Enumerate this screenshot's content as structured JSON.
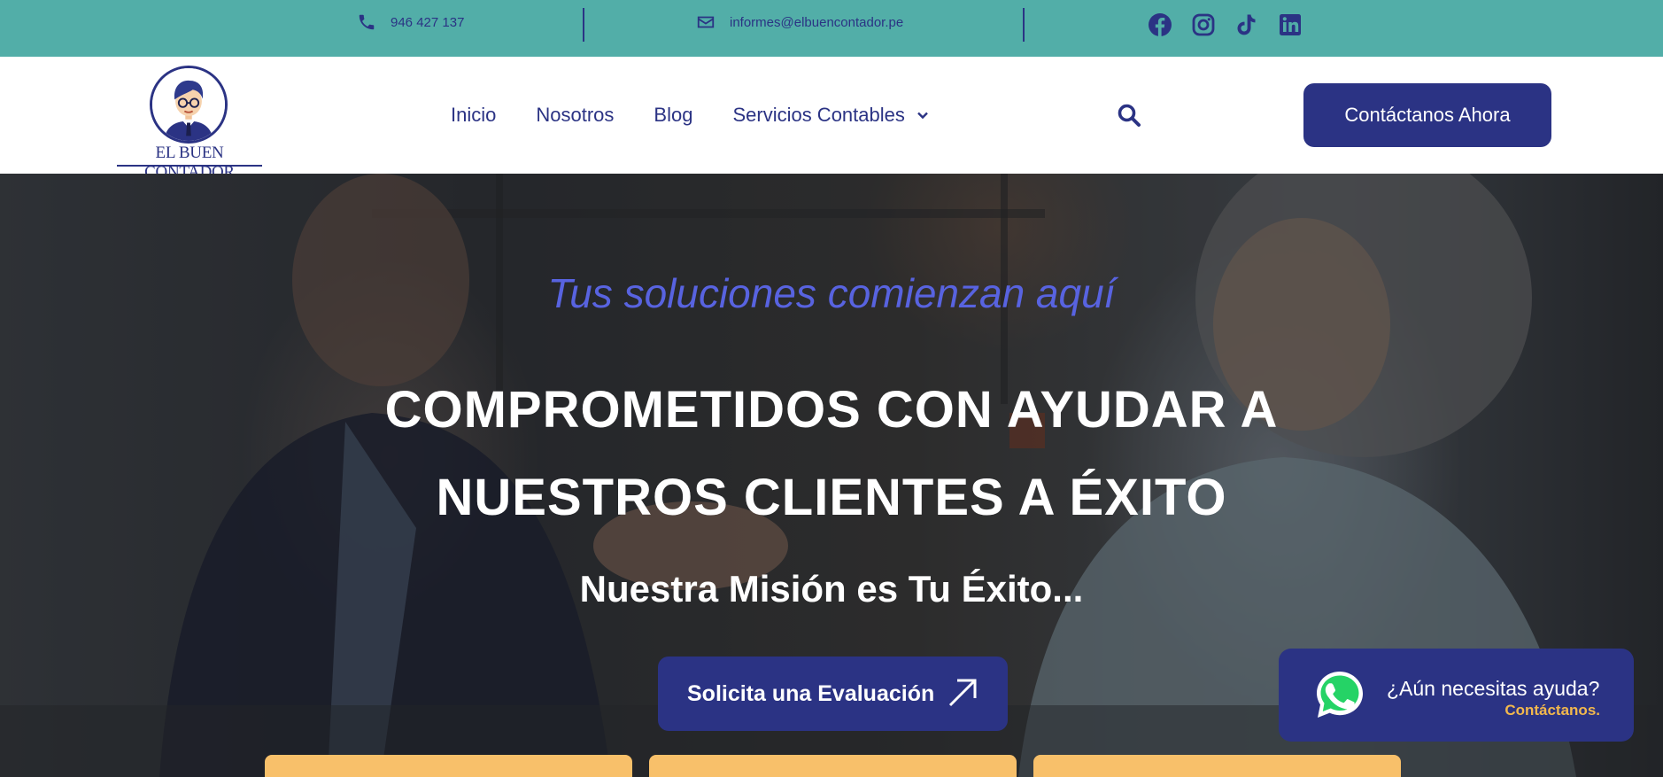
{
  "topbar": {
    "phone": "946 427 137",
    "email": "informes@elbuencontador.pe",
    "socials": [
      "facebook-icon",
      "instagram-icon",
      "tiktok-icon",
      "linkedin-icon"
    ]
  },
  "header": {
    "logo_text": "EL BUEN CONTADOR",
    "nav": [
      "Inicio",
      "Nosotros",
      "Blog",
      "Servicios Contables"
    ],
    "cta": "Contáctanos Ahora"
  },
  "hero": {
    "tagline": "Tus soluciones comienzan aquí",
    "headline_line1": "COMPROMETIDOS CON AYUDAR A",
    "headline_line2": "NUESTROS CLIENTES A ÉXITO",
    "mission": "Nuestra Misión es Tu Éxito...",
    "cta": "Solicita una Evaluación"
  },
  "whatsapp": {
    "title": "¿Aún necesitas ayuda?",
    "subtitle": "Contáctanos."
  },
  "colors": {
    "topbar_bg": "#52aea8",
    "brand_navy": "#2b3384",
    "tagline": "#5863e0",
    "card": "#f8c06a",
    "accent_gold": "#f2b84d"
  }
}
